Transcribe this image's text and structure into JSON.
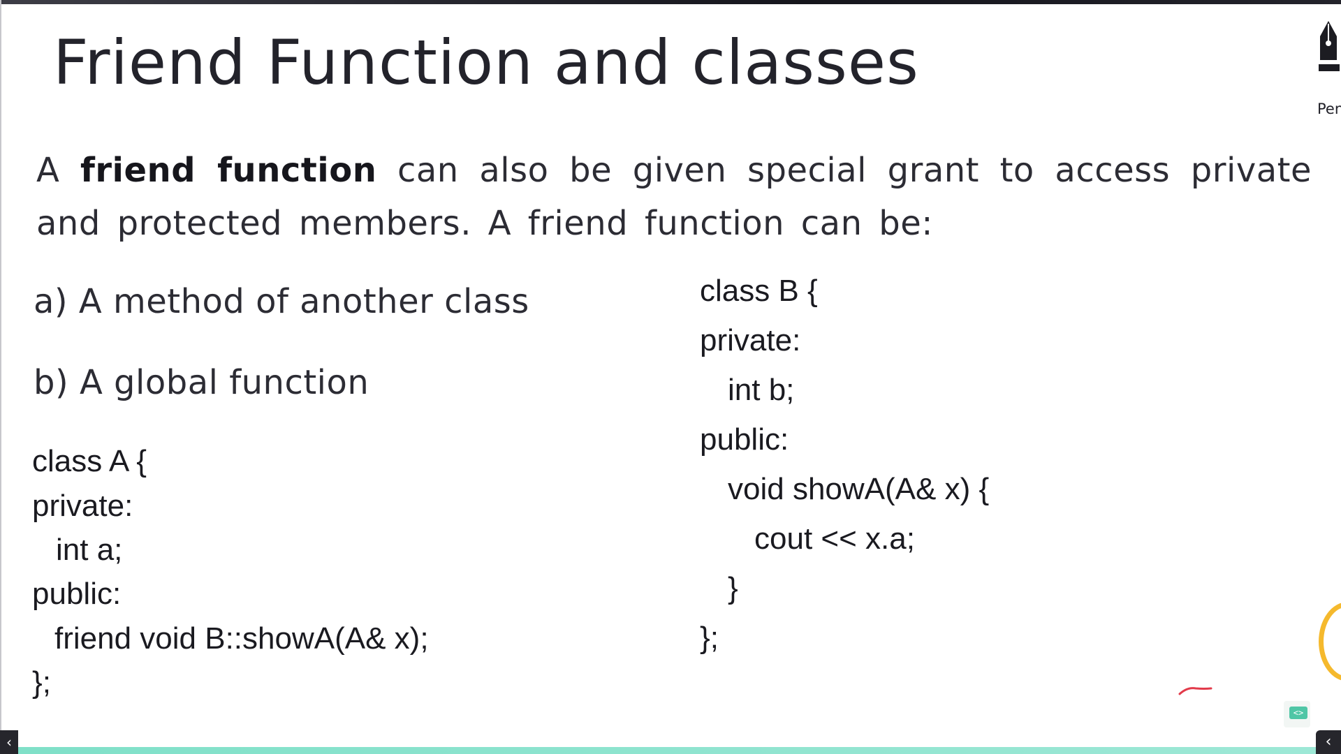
{
  "slide": {
    "title": "Friend Function and classes",
    "intro": {
      "prefix": "A",
      "bold": "friend function",
      "rest": "can also be given special grant to access private and protected members. A friend function can be:"
    },
    "options": [
      "a) A method of another class",
      "b) A global function"
    ]
  },
  "code_a": [
    "class A {",
    "private:",
    "  int a;",
    "public:",
    "  friend void B::showA(A& x);",
    "};"
  ],
  "code_b": [
    "class B {",
    "private:",
    "  int b;",
    "public:",
    "  void showA(A& x) {",
    "    cout << x.a;",
    "  }",
    "};"
  ],
  "tools": {
    "pen_label": "Pen",
    "code_badge": "<>"
  },
  "nav": {
    "prev_icon": "chevron-left",
    "next_icon": "chevron-left"
  },
  "colors": {
    "bottom_bar": "#8fe3cf",
    "ring": "#f5b92d",
    "scribble": "#e23a4a",
    "code_badge": "#4fc6a6"
  }
}
